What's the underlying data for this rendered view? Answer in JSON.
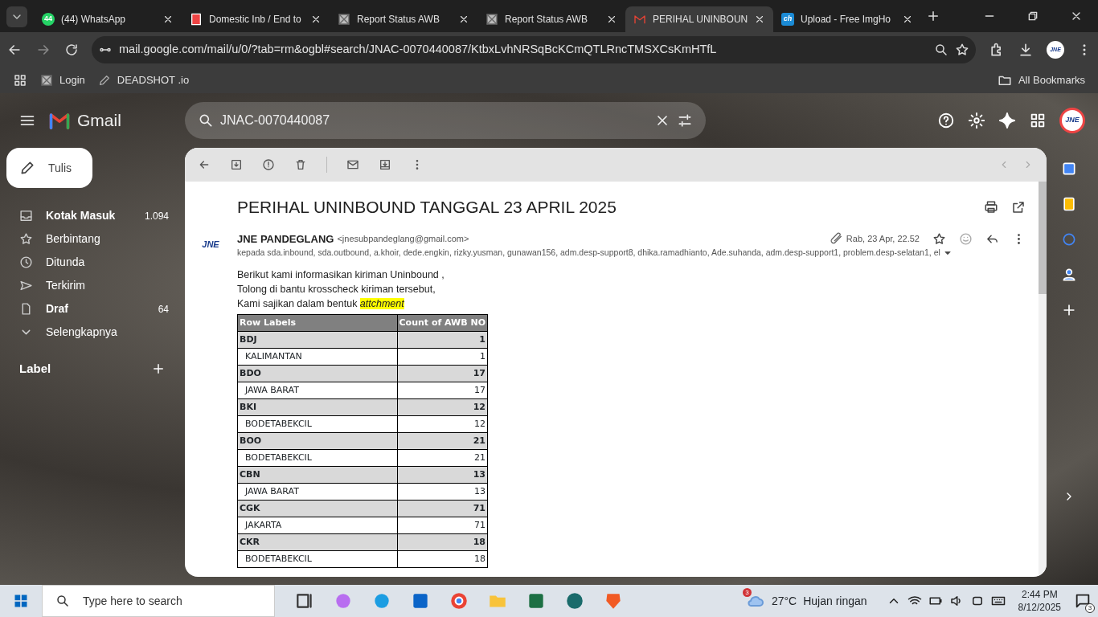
{
  "browser": {
    "tabs": [
      {
        "title": "(44) WhatsApp",
        "selected": false,
        "kind": "badge",
        "badge": "44"
      },
      {
        "title": "Domestic Inb / End to",
        "selected": false,
        "kind": "doc"
      },
      {
        "title": "Report Status AWB",
        "selected": false,
        "kind": "image"
      },
      {
        "title": "Report Status AWB",
        "selected": false,
        "kind": "image"
      },
      {
        "title": "PERIHAL UNINBOUN",
        "selected": true,
        "kind": "mail"
      },
      {
        "title": "Upload - Free ImgHo",
        "selected": false,
        "kind": "text",
        "icon_text": "ch"
      }
    ],
    "url": "mail.google.com/mail/u/0/?tab=rm&ogbl#search/JNAC-0070440087/KtbxLvhNRSqBcKCmQTLRncTMSXCsKmHTfL",
    "profile": "JNE",
    "bookmarks": [
      {
        "title": "Login",
        "kind": "image"
      },
      {
        "title": "DEADSHOT .io",
        "kind": "pen"
      }
    ],
    "all_bookmarks": "All Bookmarks"
  },
  "gmail": {
    "app_name": "Gmail",
    "search_query": "JNAC-0070440087",
    "avatar": "JNE",
    "compose": "Tulis",
    "nav_items": [
      {
        "label": "Kotak Masuk",
        "count": "1.094",
        "bold": true
      },
      {
        "label": "Berbintang",
        "bold": false
      },
      {
        "label": "Ditunda",
        "bold": false
      },
      {
        "label": "Terkirim",
        "bold": false
      },
      {
        "label": "Draf",
        "count": "64",
        "bold": true
      },
      {
        "label": "Selengkapnya",
        "bold": false
      }
    ],
    "labels_heading": "Label"
  },
  "email": {
    "subject": "PERIHAL UNINBOUND TANGGAL 23 APRIL 2025",
    "sender_logo": "JNE",
    "sender_name": "JNE PANDEGLANG",
    "sender_email": "<jnesubpandeglang@gmail.com>",
    "date": "Rab, 23 Apr, 22.52",
    "recipients": "kepada sda.inbound, sda.outbound, a.khoir, dede.engkin, rizky.yusman, gunawan156, adm.desp-support8, dhika.ramadhianto, Ade.suhanda, adm.desp-support1, problem.desp-selatan1, el",
    "body": [
      "Berikut kami informasikan kiriman Uninbound ,",
      "Tolong di bantu krosscheck kiriman tersebut,",
      "Kami sajikan dalam bentuk *attchment*"
    ],
    "table": {
      "columns": [
        "Row Labels",
        "Count of AWB NO"
      ],
      "rows": [
        {
          "kind": "group",
          "label": "BDJ",
          "count": "1"
        },
        {
          "kind": "item",
          "label": "KALIMANTAN",
          "count": "1"
        },
        {
          "kind": "group",
          "label": "BDO",
          "count": "17"
        },
        {
          "kind": "item",
          "label": "JAWA BARAT",
          "count": "17"
        },
        {
          "kind": "group",
          "label": "BKI",
          "count": "12"
        },
        {
          "kind": "item",
          "label": "BODETABEKCIL",
          "count": "12"
        },
        {
          "kind": "group",
          "label": "BOO",
          "count": "21"
        },
        {
          "kind": "item",
          "label": "BODETABEKCIL",
          "count": "21"
        },
        {
          "kind": "group",
          "label": "CBN",
          "count": "13"
        },
        {
          "kind": "item",
          "label": "JAWA BARAT",
          "count": "13"
        },
        {
          "kind": "group",
          "label": "CGK",
          "count": "71"
        },
        {
          "kind": "item",
          "label": "JAKARTA",
          "count": "71"
        },
        {
          "kind": "group",
          "label": "CKR",
          "count": "18"
        },
        {
          "kind": "item",
          "label": "BODETABEKCIL",
          "count": "18"
        }
      ]
    }
  },
  "taskbar": {
    "search_placeholder": "Type here to search",
    "weather_badge": "3",
    "temperature": "27°C",
    "weather": "Hujan ringan",
    "time": "2:44 PM",
    "date": "8/12/2025",
    "notifications": "3"
  }
}
